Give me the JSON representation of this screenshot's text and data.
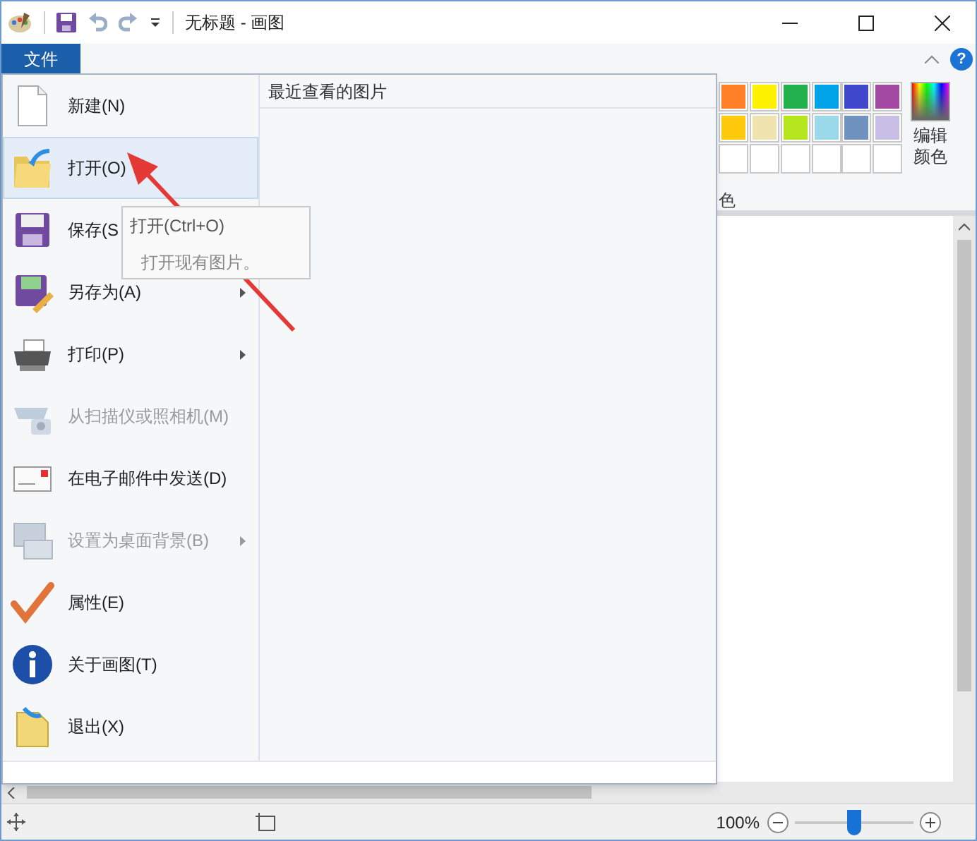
{
  "window": {
    "title": "无标题 - 画图"
  },
  "ribbon": {
    "file_tab": "文件",
    "help_button": "?",
    "colors_label": "色",
    "edit_colors": [
      "编辑",
      "颜色"
    ],
    "palette": [
      {
        "color": "#ff7f27"
      },
      {
        "color": "#fff200"
      },
      {
        "color": "#22b14c"
      },
      {
        "color": "#00a2e8"
      },
      {
        "color": "#3f48cc"
      },
      {
        "color": "#a349a4"
      },
      {
        "color": "#ffc90e"
      },
      {
        "color": "#efe4b0"
      },
      {
        "color": "#b5e61d"
      },
      {
        "color": "#99d9ea"
      },
      {
        "color": "#7092be"
      },
      {
        "color": "#c8bfe7"
      }
    ]
  },
  "file_menu": {
    "recent_header": "最近查看的图片",
    "items": [
      {
        "label": "新建(N)",
        "selected": false,
        "disabled": false,
        "submenu": false
      },
      {
        "label": "打开(O)",
        "selected": true,
        "disabled": false,
        "submenu": false
      },
      {
        "label": "保存(S",
        "selected": false,
        "disabled": false,
        "submenu": false
      },
      {
        "label": "另存为(A)",
        "selected": false,
        "disabled": false,
        "submenu": true
      },
      {
        "label": "打印(P)",
        "selected": false,
        "disabled": false,
        "submenu": true
      },
      {
        "label": "从扫描仪或照相机(M)",
        "selected": false,
        "disabled": true,
        "submenu": false
      },
      {
        "label": "在电子邮件中发送(D)",
        "selected": false,
        "disabled": false,
        "submenu": false
      },
      {
        "label": "设置为桌面背景(B)",
        "selected": false,
        "disabled": true,
        "submenu": true
      },
      {
        "label": "属性(E)",
        "selected": false,
        "disabled": false,
        "submenu": false
      },
      {
        "label": "关于画图(T)",
        "selected": false,
        "disabled": false,
        "submenu": false
      },
      {
        "label": "退出(X)",
        "selected": false,
        "disabled": false,
        "submenu": false
      }
    ]
  },
  "tooltip": {
    "title": "打开(Ctrl+O)",
    "text": "打开现有图片。"
  },
  "status_bar": {
    "zoom": "100%",
    "zoom_slider": {
      "level": 0.5
    }
  }
}
